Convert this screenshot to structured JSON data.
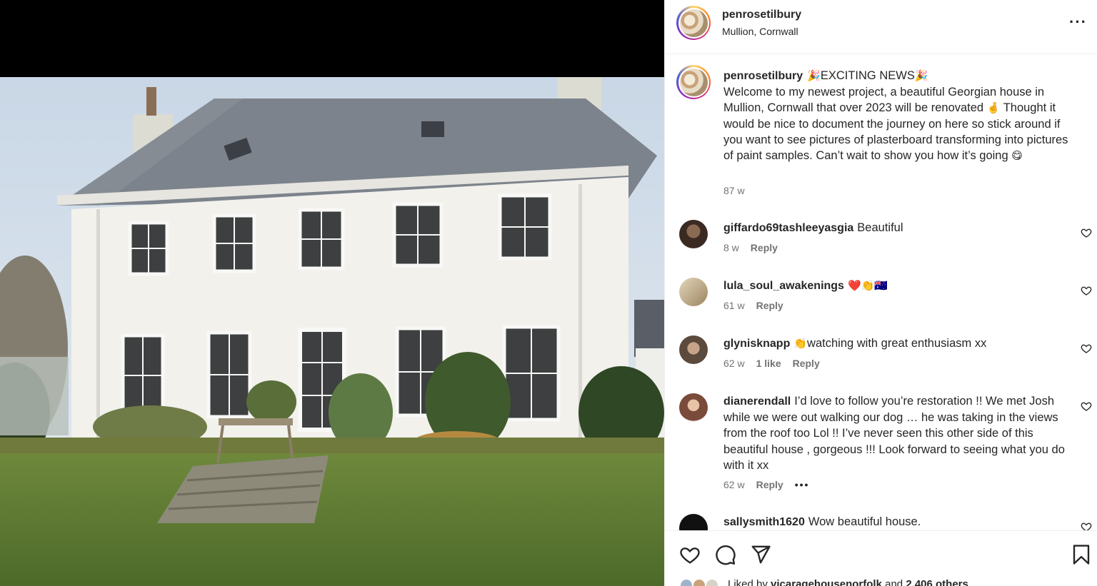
{
  "post": {
    "username": "penrosetilbury",
    "location": "Mullion, Cornwall",
    "caption_emoji_1": "🎉",
    "caption_title": "EXCITING NEWS",
    "caption_emoji_2": "🎉",
    "caption_text_1": "Welcome to my newest project, a beautiful Georgian house in Mullion, Cornwall that over 2023 will be renovated",
    "caption_emoji_3": "🤞",
    "caption_text_2": "Thought it would be nice to document the journey on here so stick around if you want to see pictures of plasterboard transforming into pictures of paint samples. Can’t wait to show you how it’s going",
    "caption_emoji_4": "😋",
    "time": "87 w"
  },
  "comments": [
    {
      "username": "giffardo69tashleeyasgia",
      "text": "Beautiful",
      "emoji": "",
      "time": "8 w",
      "likes": "",
      "reply": "Reply",
      "avatar_color": "#3a2a22"
    },
    {
      "username": "lula_soul_awakenings",
      "text": "",
      "emoji": "❤️👏🇦🇺",
      "time": "61 w",
      "likes": "",
      "reply": "Reply",
      "avatar_color": "#b9a37e"
    },
    {
      "username": "glynisknapp",
      "text": "watching with great enthusiasm xx",
      "emoji": "👏",
      "time": "62 w",
      "likes": "1 like",
      "reply": "Reply",
      "avatar_color": "#5c4a3c"
    },
    {
      "username": "dianerendall",
      "text": "I’d love to follow you’re restoration !! We met Josh while we were out walking our dog … he was taking in the views from the roof too Lol !! I’ve never seen this other side of this beautiful house , gorgeous !!! Look forward to seeing what you do with it xx",
      "emoji": "",
      "time": "62 w",
      "likes": "",
      "reply": "Reply",
      "avatar_color": "#c98a70",
      "more": "•••"
    },
    {
      "username": "sallysmith1620",
      "text": "Wow beautiful house.",
      "emoji": "",
      "avatar_color": "#111111"
    }
  ],
  "likes": {
    "prefix": "Liked by",
    "user": "vicaragehousenorfolk",
    "middle": "and",
    "count": "2,406 others"
  },
  "icons": {
    "more": "more-options-icon",
    "like": "heart-icon",
    "comment": "comment-icon",
    "share": "paper-plane-icon",
    "save": "bookmark-icon"
  }
}
